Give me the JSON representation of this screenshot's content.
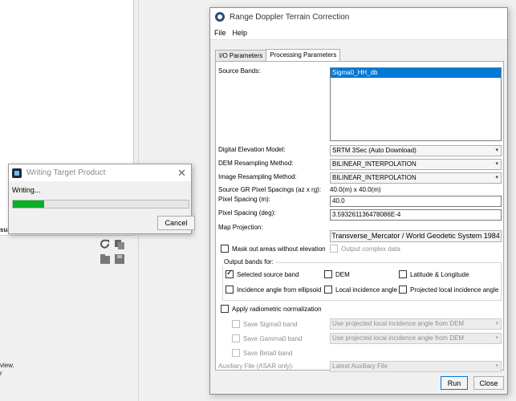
{
  "background": {
    "fragments": [
      "sua",
      "view.",
      "r"
    ]
  },
  "progress_dialog": {
    "title": "Writing Target Product",
    "message": "Writing...",
    "progress_percent": 18,
    "cancel_label": "Cancel",
    "close_glyph": "✕"
  },
  "dialog": {
    "title": "Range Doppler Terrain Correction",
    "menu": [
      "File",
      "Help"
    ],
    "tabs": [
      "I/O Parameters",
      "Processing Parameters"
    ],
    "active_tab": "Processing Parameters",
    "source_bands_label": "Source Bands:",
    "source_bands": [
      "Sigma0_HH_db"
    ],
    "dem_label": "Digital Elevation Model:",
    "dem_value": "SRTM 3Sec (Auto Download)",
    "dem_resampling_label": "DEM Resampling Method:",
    "dem_resampling_value": "BILINEAR_INTERPOLATION",
    "img_resampling_label": "Image Resampling Method:",
    "img_resampling_value": "BILINEAR_INTERPOLATION",
    "pixel_spacings_label": "Source GR Pixel Spacings (az x rg):",
    "pixel_spacings_value": "40.0(m) x 40.0(m)",
    "pixel_spacing_m_label": "Pixel Spacing (m):",
    "pixel_spacing_m_value": "40.0",
    "pixel_spacing_deg_label": "Pixel Spacing (deg):",
    "pixel_spacing_deg_value": "3.593261136478086E-4",
    "map_projection_label": "Map Projection:",
    "map_projection_value": "Transverse_Mercator / World Geodetic System 1984",
    "mask_label": "Mask out areas without elevation",
    "output_complex_label": "Output complex data",
    "output_bands_label": "Output bands for:",
    "output_bands": {
      "selected_source_band": "Selected source band",
      "dem": "DEM",
      "lat_lon": "Latitude & Longitude",
      "incidence_ellipsoid": "Incidence angle from ellipsoid",
      "local_incidence": "Local incidence angle",
      "projected_local_incidence": "Projected local incidence angle"
    },
    "radiometric_label": "Apply radiometric normalization",
    "save_sigma0_label": "Save Sigma0 band",
    "save_sigma0_value": "Use projected local incidence angle from DEM",
    "save_gamma0_label": "Save Gamma0 band",
    "save_gamma0_value": "Use projected local incidence angle from DEM",
    "save_beta0_label": "Save Beta0 band",
    "aux_label": "Auxiliary File (ASAR only):",
    "aux_value": "Latest Auxiliary File",
    "run_label": "Run",
    "close_label": "Close",
    "dropdown_glyph": "▾"
  }
}
